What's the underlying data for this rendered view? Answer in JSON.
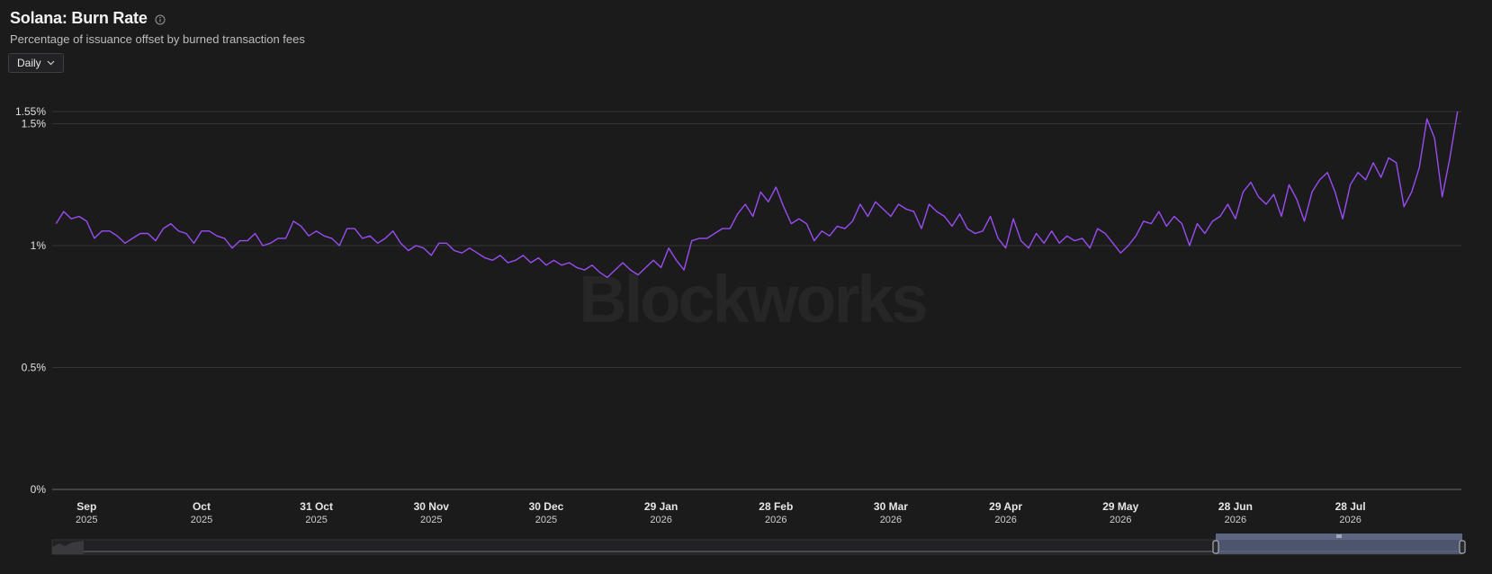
{
  "header": {
    "title": "Solana: Burn Rate",
    "subtitle": "Percentage of issuance offset by burned transaction fees",
    "info_icon": "info-circle-icon"
  },
  "controls": {
    "interval_label": "Daily",
    "interval_icon": "chevron-down-icon"
  },
  "watermark": "Blockworks",
  "colors": {
    "background": "#1b1b1c",
    "line": "#9a4cf2",
    "grid": "#343436",
    "navigator_selection": "#5b6783"
  },
  "chart_data": {
    "type": "line",
    "title": "Solana: Burn Rate",
    "subtitle": "Percentage of issuance offset by burned transaction fees",
    "y_unit": "%",
    "ylim": [
      0,
      1.55
    ],
    "y_ticks": [
      {
        "value": 0,
        "label": "0%"
      },
      {
        "value": 0.5,
        "label": "0.5%"
      },
      {
        "value": 1,
        "label": "1%"
      },
      {
        "value": 1.5,
        "label": "1.5%"
      },
      {
        "value": 1.55,
        "label": "1.55%"
      }
    ],
    "xlim": [
      "2025-08-23",
      "2026-08-26"
    ],
    "x_ticks": [
      {
        "date": "2025-09-01",
        "label": "Sep",
        "sublabel": "2025"
      },
      {
        "date": "2025-10-01",
        "label": "Oct",
        "sublabel": "2025"
      },
      {
        "date": "2025-10-31",
        "label": "31 Oct",
        "sublabel": "2025"
      },
      {
        "date": "2025-11-30",
        "label": "30 Nov",
        "sublabel": "2025"
      },
      {
        "date": "2025-12-30",
        "label": "30 Dec",
        "sublabel": "2025"
      },
      {
        "date": "2026-01-29",
        "label": "29 Jan",
        "sublabel": "2026"
      },
      {
        "date": "2026-02-28",
        "label": "28 Feb",
        "sublabel": "2026"
      },
      {
        "date": "2026-03-30",
        "label": "30 Mar",
        "sublabel": "2026"
      },
      {
        "date": "2026-04-29",
        "label": "29 Apr",
        "sublabel": "2026"
      },
      {
        "date": "2026-05-29",
        "label": "29 May",
        "sublabel": "2026"
      },
      {
        "date": "2026-06-28",
        "label": "28 Jun",
        "sublabel": "2026"
      },
      {
        "date": "2026-07-28",
        "label": "28 Jul",
        "sublabel": "2026"
      }
    ],
    "grid": true,
    "legend": "none",
    "series": [
      {
        "points": [
          [
            "2025-08-24",
            1.09
          ],
          [
            "2025-08-26",
            1.14
          ],
          [
            "2025-08-28",
            1.11
          ],
          [
            "2025-08-30",
            1.12
          ],
          [
            "2025-09-01",
            1.1
          ],
          [
            "2025-09-03",
            1.03
          ],
          [
            "2025-09-05",
            1.06
          ],
          [
            "2025-09-07",
            1.06
          ],
          [
            "2025-09-09",
            1.04
          ],
          [
            "2025-09-11",
            1.01
          ],
          [
            "2025-09-13",
            1.03
          ],
          [
            "2025-09-15",
            1.05
          ],
          [
            "2025-09-17",
            1.05
          ],
          [
            "2025-09-19",
            1.02
          ],
          [
            "2025-09-21",
            1.07
          ],
          [
            "2025-09-23",
            1.09
          ],
          [
            "2025-09-25",
            1.06
          ],
          [
            "2025-09-27",
            1.05
          ],
          [
            "2025-09-29",
            1.01
          ],
          [
            "2025-10-01",
            1.06
          ],
          [
            "2025-10-03",
            1.06
          ],
          [
            "2025-10-05",
            1.04
          ],
          [
            "2025-10-07",
            1.03
          ],
          [
            "2025-10-09",
            0.99
          ],
          [
            "2025-10-11",
            1.02
          ],
          [
            "2025-10-13",
            1.02
          ],
          [
            "2025-10-15",
            1.05
          ],
          [
            "2025-10-17",
            1.0
          ],
          [
            "2025-10-19",
            1.01
          ],
          [
            "2025-10-21",
            1.03
          ],
          [
            "2025-10-23",
            1.03
          ],
          [
            "2025-10-25",
            1.1
          ],
          [
            "2025-10-27",
            1.08
          ],
          [
            "2025-10-29",
            1.04
          ],
          [
            "2025-10-31",
            1.06
          ],
          [
            "2025-11-02",
            1.04
          ],
          [
            "2025-11-04",
            1.03
          ],
          [
            "2025-11-06",
            1.0
          ],
          [
            "2025-11-08",
            1.07
          ],
          [
            "2025-11-10",
            1.07
          ],
          [
            "2025-11-12",
            1.03
          ],
          [
            "2025-11-14",
            1.04
          ],
          [
            "2025-11-16",
            1.01
          ],
          [
            "2025-11-18",
            1.03
          ],
          [
            "2025-11-20",
            1.06
          ],
          [
            "2025-11-22",
            1.01
          ],
          [
            "2025-11-24",
            0.98
          ],
          [
            "2025-11-26",
            1.0
          ],
          [
            "2025-11-28",
            0.99
          ],
          [
            "2025-11-30",
            0.96
          ],
          [
            "2025-12-02",
            1.01
          ],
          [
            "2025-12-04",
            1.01
          ],
          [
            "2025-12-06",
            0.98
          ],
          [
            "2025-12-08",
            0.97
          ],
          [
            "2025-12-10",
            0.99
          ],
          [
            "2025-12-12",
            0.97
          ],
          [
            "2025-12-14",
            0.95
          ],
          [
            "2025-12-16",
            0.94
          ],
          [
            "2025-12-18",
            0.96
          ],
          [
            "2025-12-20",
            0.93
          ],
          [
            "2025-12-22",
            0.94
          ],
          [
            "2025-12-24",
            0.96
          ],
          [
            "2025-12-26",
            0.93
          ],
          [
            "2025-12-28",
            0.95
          ],
          [
            "2025-12-30",
            0.92
          ],
          [
            "2026-01-01",
            0.94
          ],
          [
            "2026-01-03",
            0.92
          ],
          [
            "2026-01-05",
            0.93
          ],
          [
            "2026-01-07",
            0.91
          ],
          [
            "2026-01-09",
            0.9
          ],
          [
            "2026-01-11",
            0.92
          ],
          [
            "2026-01-13",
            0.89
          ],
          [
            "2026-01-15",
            0.87
          ],
          [
            "2026-01-17",
            0.9
          ],
          [
            "2026-01-19",
            0.93
          ],
          [
            "2026-01-21",
            0.9
          ],
          [
            "2026-01-23",
            0.88
          ],
          [
            "2026-01-25",
            0.91
          ],
          [
            "2026-01-27",
            0.94
          ],
          [
            "2026-01-29",
            0.91
          ],
          [
            "2026-01-31",
            0.99
          ],
          [
            "2026-02-02",
            0.94
          ],
          [
            "2026-02-04",
            0.9
          ],
          [
            "2026-02-06",
            1.02
          ],
          [
            "2026-02-08",
            1.03
          ],
          [
            "2026-02-10",
            1.03
          ],
          [
            "2026-02-12",
            1.05
          ],
          [
            "2026-02-14",
            1.07
          ],
          [
            "2026-02-16",
            1.07
          ],
          [
            "2026-02-18",
            1.13
          ],
          [
            "2026-02-20",
            1.17
          ],
          [
            "2026-02-22",
            1.12
          ],
          [
            "2026-02-24",
            1.22
          ],
          [
            "2026-02-26",
            1.18
          ],
          [
            "2026-02-28",
            1.24
          ],
          [
            "2026-03-02",
            1.16
          ],
          [
            "2026-03-04",
            1.09
          ],
          [
            "2026-03-06",
            1.11
          ],
          [
            "2026-03-08",
            1.09
          ],
          [
            "2026-03-10",
            1.02
          ],
          [
            "2026-03-12",
            1.06
          ],
          [
            "2026-03-14",
            1.04
          ],
          [
            "2026-03-16",
            1.08
          ],
          [
            "2026-03-18",
            1.07
          ],
          [
            "2026-03-20",
            1.1
          ],
          [
            "2026-03-22",
            1.17
          ],
          [
            "2026-03-24",
            1.12
          ],
          [
            "2026-03-26",
            1.18
          ],
          [
            "2026-03-28",
            1.15
          ],
          [
            "2026-03-30",
            1.12
          ],
          [
            "2026-04-01",
            1.17
          ],
          [
            "2026-04-03",
            1.15
          ],
          [
            "2026-04-05",
            1.14
          ],
          [
            "2026-04-07",
            1.07
          ],
          [
            "2026-04-09",
            1.17
          ],
          [
            "2026-04-11",
            1.14
          ],
          [
            "2026-04-13",
            1.12
          ],
          [
            "2026-04-15",
            1.08
          ],
          [
            "2026-04-17",
            1.13
          ],
          [
            "2026-04-19",
            1.07
          ],
          [
            "2026-04-21",
            1.05
          ],
          [
            "2026-04-23",
            1.06
          ],
          [
            "2026-04-25",
            1.12
          ],
          [
            "2026-04-27",
            1.03
          ],
          [
            "2026-04-29",
            0.99
          ],
          [
            "2026-05-01",
            1.11
          ],
          [
            "2026-05-03",
            1.02
          ],
          [
            "2026-05-05",
            0.99
          ],
          [
            "2026-05-07",
            1.05
          ],
          [
            "2026-05-09",
            1.01
          ],
          [
            "2026-05-11",
            1.06
          ],
          [
            "2026-05-13",
            1.01
          ],
          [
            "2026-05-15",
            1.04
          ],
          [
            "2026-05-17",
            1.02
          ],
          [
            "2026-05-19",
            1.03
          ],
          [
            "2026-05-21",
            0.99
          ],
          [
            "2026-05-23",
            1.07
          ],
          [
            "2026-05-25",
            1.05
          ],
          [
            "2026-05-27",
            1.01
          ],
          [
            "2026-05-29",
            0.97
          ],
          [
            "2026-05-31",
            1.0
          ],
          [
            "2026-06-02",
            1.04
          ],
          [
            "2026-06-04",
            1.1
          ],
          [
            "2026-06-06",
            1.09
          ],
          [
            "2026-06-08",
            1.14
          ],
          [
            "2026-06-10",
            1.08
          ],
          [
            "2026-06-12",
            1.12
          ],
          [
            "2026-06-14",
            1.09
          ],
          [
            "2026-06-16",
            1.0
          ],
          [
            "2026-06-18",
            1.09
          ],
          [
            "2026-06-20",
            1.05
          ],
          [
            "2026-06-22",
            1.1
          ],
          [
            "2026-06-24",
            1.12
          ],
          [
            "2026-06-26",
            1.17
          ],
          [
            "2026-06-28",
            1.11
          ],
          [
            "2026-06-30",
            1.22
          ],
          [
            "2026-07-02",
            1.26
          ],
          [
            "2026-07-04",
            1.2
          ],
          [
            "2026-07-06",
            1.17
          ],
          [
            "2026-07-08",
            1.21
          ],
          [
            "2026-07-10",
            1.12
          ],
          [
            "2026-07-12",
            1.25
          ],
          [
            "2026-07-14",
            1.19
          ],
          [
            "2026-07-16",
            1.1
          ],
          [
            "2026-07-18",
            1.22
          ],
          [
            "2026-07-20",
            1.27
          ],
          [
            "2026-07-22",
            1.3
          ],
          [
            "2026-07-24",
            1.22
          ],
          [
            "2026-07-26",
            1.11
          ],
          [
            "2026-07-28",
            1.25
          ],
          [
            "2026-07-30",
            1.3
          ],
          [
            "2026-08-01",
            1.27
          ],
          [
            "2026-08-03",
            1.34
          ],
          [
            "2026-08-05",
            1.28
          ],
          [
            "2026-08-07",
            1.36
          ],
          [
            "2026-08-09",
            1.34
          ],
          [
            "2026-08-11",
            1.16
          ],
          [
            "2026-08-13",
            1.22
          ],
          [
            "2026-08-15",
            1.32
          ],
          [
            "2026-08-17",
            1.52
          ],
          [
            "2026-08-19",
            1.44
          ],
          [
            "2026-08-21",
            1.2
          ],
          [
            "2026-08-23",
            1.36
          ],
          [
            "2026-08-25",
            1.55
          ]
        ]
      }
    ]
  }
}
